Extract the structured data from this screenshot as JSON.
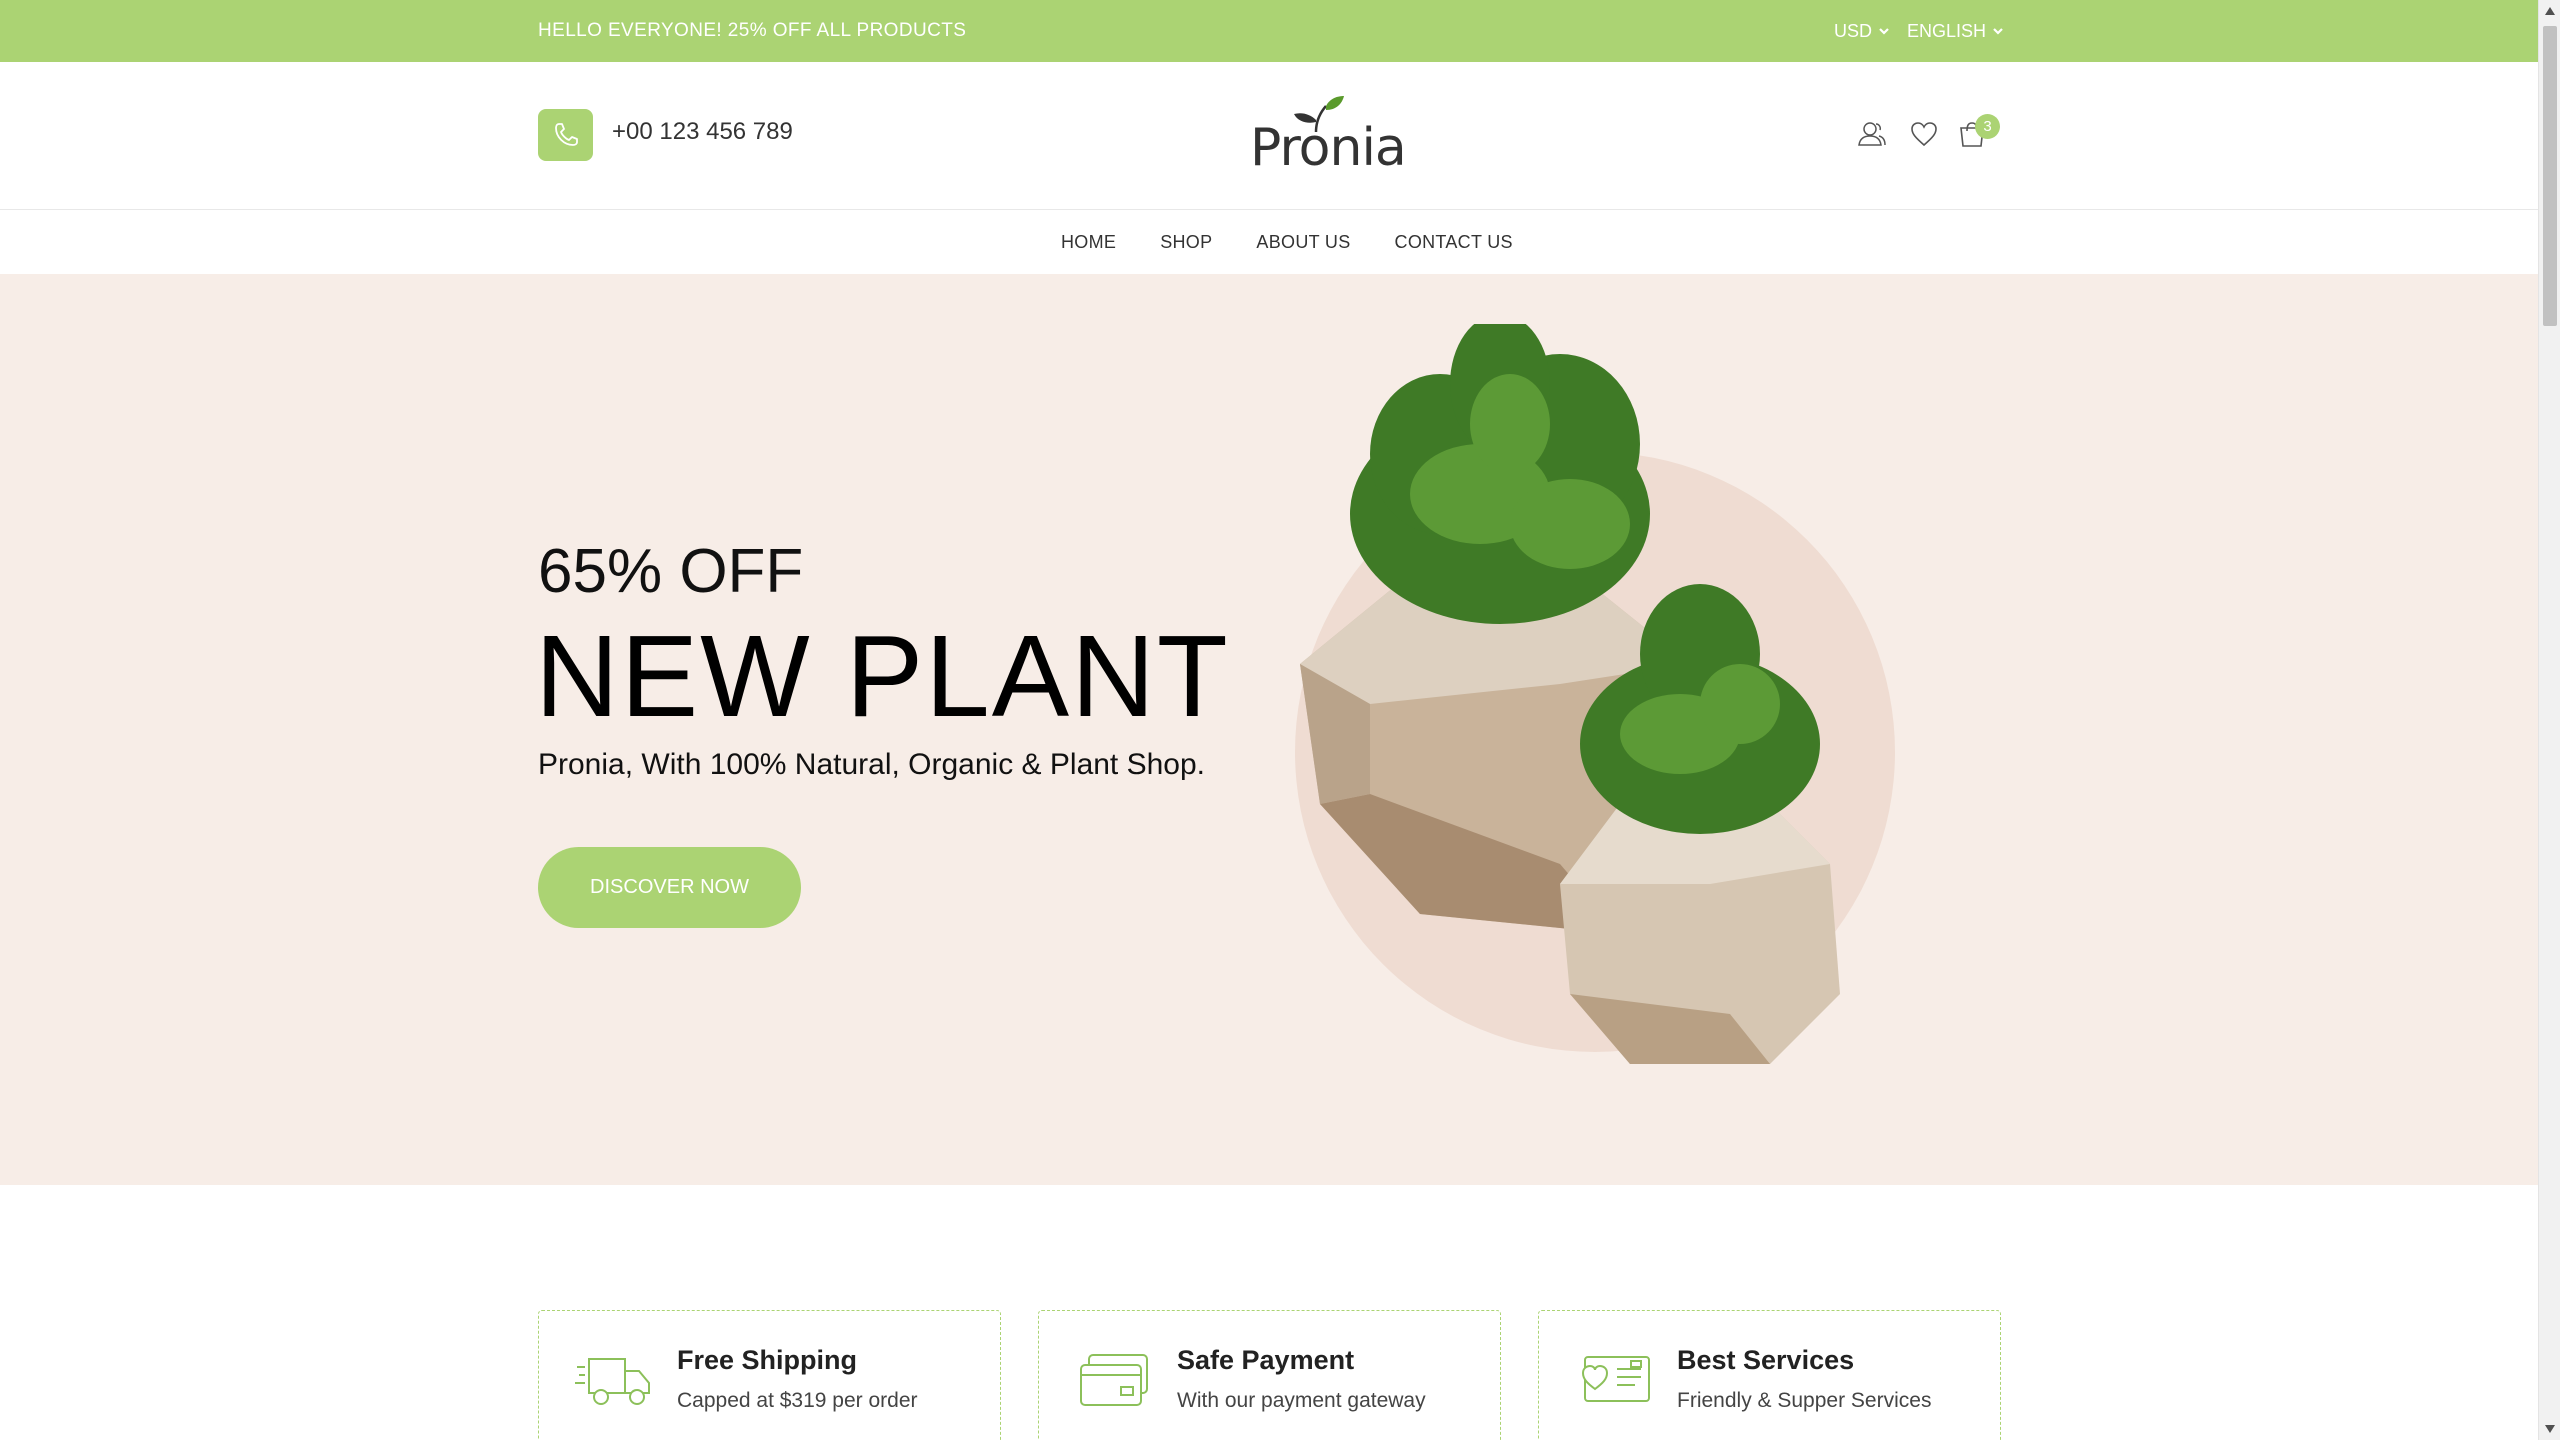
{
  "topbar": {
    "promo": "HELLO EVERYONE! 25% OFF ALL PRODUCTS",
    "currency": "USD",
    "language": "ENGLISH"
  },
  "header": {
    "phone": "+00 123 456 789",
    "logo_text": "Pronia",
    "cart_count": "3"
  },
  "nav": {
    "items": [
      "HOME",
      "SHOP",
      "ABOUT US",
      "CONTACT US"
    ]
  },
  "hero": {
    "offer": "65% OFF",
    "title": "NEW PLANT",
    "subtitle": "Pronia, With 100% Natural, Organic & Plant Shop.",
    "button": "DISCOVER NOW"
  },
  "features": [
    {
      "title": "Free Shipping",
      "desc": "Capped at $319 per order",
      "icon": "delivery-truck-icon"
    },
    {
      "title": "Safe Payment",
      "desc": "With our payment gateway",
      "icon": "credit-card-icon"
    },
    {
      "title": "Best Services",
      "desc": "Friendly & Supper Services",
      "icon": "service-card-icon"
    }
  ],
  "colors": {
    "accent": "#abd373",
    "hero_bg": "#f7ede7",
    "text": "#222222"
  }
}
